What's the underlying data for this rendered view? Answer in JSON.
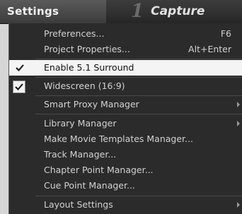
{
  "menubar": {
    "title": "Settings",
    "step_number": "1",
    "step_label": "Capture"
  },
  "menu": {
    "items": [
      {
        "label": "Preferences...",
        "shortcut": "F6"
      },
      {
        "label": "Project Properties...",
        "shortcut": "Alt+Enter"
      },
      {
        "label": "Enable 5.1 Surround",
        "checked": true
      },
      {
        "label": "Widescreen (16:9)",
        "checked": true
      },
      {
        "label": "Smart Proxy Manager",
        "submenu": true
      },
      {
        "label": "Library Manager",
        "submenu": true
      },
      {
        "label": "Make Movie Templates Manager..."
      },
      {
        "label": "Track Manager..."
      },
      {
        "label": "Chapter Point Manager..."
      },
      {
        "label": "Cue Point Manager..."
      },
      {
        "label": "Layout Settings",
        "submenu": true
      }
    ]
  },
  "icons": {
    "check": "checkmark-icon",
    "submenu": "submenu-arrow-icon"
  },
  "colors": {
    "menu_background": "#2b2b2b",
    "highlight_background": "#f4f4f4",
    "menubar_background": "#333333",
    "text": "#d2d2d2"
  }
}
